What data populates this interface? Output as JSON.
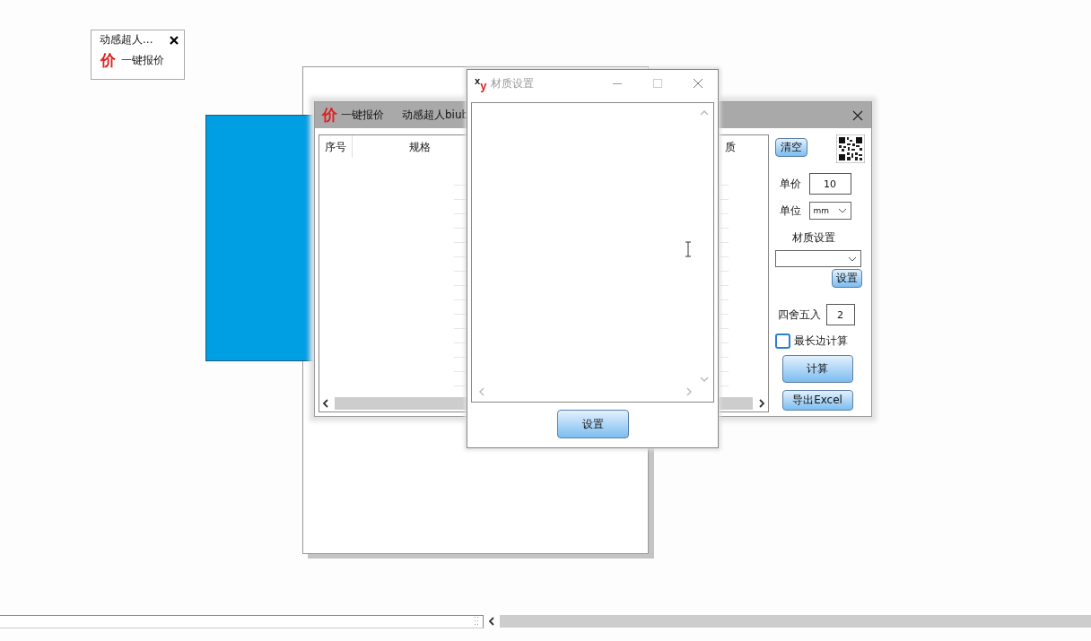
{
  "palette": {
    "title": "动感超人...",
    "icon_text": "价",
    "label": "一键报价"
  },
  "main_window": {
    "icon_text": "价",
    "title": "一键报价",
    "subtitle": "动感超人biub",
    "table": {
      "columns": [
        "序号",
        "规格",
        "质"
      ]
    },
    "clear_button": "清空",
    "unit_price": {
      "label": "单价",
      "value": "10"
    },
    "unit": {
      "label": "单位",
      "value": "mm"
    },
    "material": {
      "label": "材质设置",
      "button": "设置"
    },
    "rounding": {
      "label": "四舍五入",
      "value": "2"
    },
    "longest_edge": {
      "label": "最长边计算",
      "checked": false
    },
    "calculate_button": "计算",
    "export_button": "导出Excel"
  },
  "dialog": {
    "logo": [
      "x",
      "y"
    ],
    "title": "材质设置",
    "button": "设置"
  }
}
